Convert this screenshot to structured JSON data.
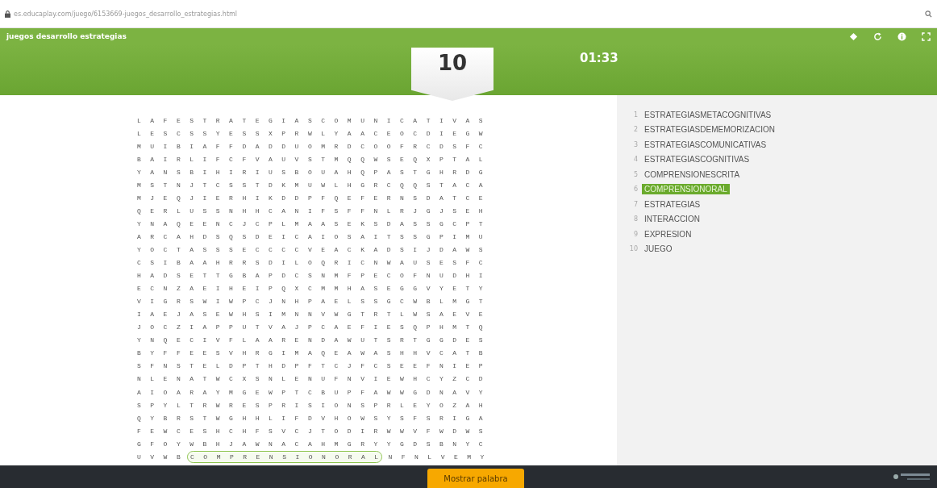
{
  "browser": {
    "url": "es.educaplay.com/juego/6153669-juegos_desarrollo_estrategias.html"
  },
  "header": {
    "title": "juegos desarrollo estrategias"
  },
  "score": "10",
  "timer": "01:33",
  "grid": {
    "rows": [
      {
        "segments": [
          {
            "text": "L A F E S T R A T E G I A S C O M U N I C A T I V A S",
            "found": false
          }
        ]
      },
      {
        "segments": [
          {
            "text": "L E S C S S Y E S S X P R W L Y A A C E O C D I E G W",
            "found": false
          }
        ]
      },
      {
        "segments": [
          {
            "text": "M U I B I A F F D A D D U O M R D C O O F R C D S F C",
            "found": false
          }
        ]
      },
      {
        "segments": [
          {
            "text": "B A I R L I F C F V A U V S T M Q Q W S E Q X P T A L",
            "found": false
          }
        ]
      },
      {
        "segments": [
          {
            "text": "Y A N S B I H I R I U S B O U A H Q P A S T G H R D G",
            "found": false
          }
        ]
      },
      {
        "segments": [
          {
            "text": "M S T N J T C S S T D K M U W L H G R C Q Q S T A C A",
            "found": false
          }
        ]
      },
      {
        "segments": [
          {
            "text": "M J E Q J I E R H I K D D P F Q E F E R N S D A T C E",
            "found": false
          }
        ]
      },
      {
        "segments": [
          {
            "text": "Q E R L U S S N H H C A N I F S F F N L R J G J S E H",
            "found": false
          }
        ]
      },
      {
        "segments": [
          {
            "text": "Y N A Q E E N C J C P L M A A S E K S D A S S G C P T",
            "found": false
          }
        ]
      },
      {
        "segments": [
          {
            "text": "A R C A H D S Q S D E I C A I O S A I T S S G P I M U",
            "found": false
          }
        ]
      },
      {
        "segments": [
          {
            "text": "Y O C T A S S S E C C C C V E A C K A D S I J D A W S",
            "found": false
          }
        ]
      },
      {
        "segments": [
          {
            "text": "C S I B A A H R R S D I L O Q R I C N W A U S E S F C",
            "found": false
          }
        ]
      },
      {
        "segments": [
          {
            "text": "H A D S E T T G B A P D C S N M F P E C O F N U D H I",
            "found": false
          }
        ]
      },
      {
        "segments": [
          {
            "text": "E C N Z A E I H E I P Q X C M M H A S E G G V Y E T Y",
            "found": false
          }
        ]
      },
      {
        "segments": [
          {
            "text": "V I G R S W I W P C J N H P A E L S S G C W B L M G T",
            "found": false
          }
        ]
      },
      {
        "segments": [
          {
            "text": "I A E J A S E W H S I M N N V W G T R T L W S A E V E",
            "found": false
          }
        ]
      },
      {
        "segments": [
          {
            "text": "J O C Z I A P P U T V A J P C A E F I E S Q P H M T Q",
            "found": false
          }
        ]
      },
      {
        "segments": [
          {
            "text": "Y N Q E C I V F L A A R E N D A W U T S R T G G D E S",
            "found": false
          }
        ]
      },
      {
        "segments": [
          {
            "text": "B Y F F E E S V H R G I M A Q E A W A S H H V C A T B",
            "found": false
          }
        ]
      },
      {
        "segments": [
          {
            "text": "S F N S T E L D P T H D P F T C J F C S E E F N I E P",
            "found": false
          }
        ]
      },
      {
        "segments": [
          {
            "text": "N L E N A T W C X S N L E N U F N V I E W H C Y Z C D",
            "found": false
          }
        ]
      },
      {
        "segments": [
          {
            "text": "A I O A R A Y M G E W P T C B U P F A W W G D N A V Y",
            "found": false
          }
        ]
      },
      {
        "segments": [
          {
            "text": "S P Y L T R W R E S P R I S I O N S P R L E Y O Z A H",
            "found": false
          }
        ]
      },
      {
        "segments": [
          {
            "text": "Q Y B R S T W G H H L I F D V H O W S Y S F S R I G A",
            "found": false
          }
        ]
      },
      {
        "segments": [
          {
            "text": "F E W C E S H C H F S V C J T O D I R W W V F W D W S",
            "found": false
          }
        ]
      },
      {
        "segments": [
          {
            "text": "G F O Y W B H J A W N A C A H M G R Y Y G D S B N Y C",
            "found": false
          }
        ]
      },
      {
        "segments": [
          {
            "text": "U V W B",
            "found": false
          },
          {
            "text": "C O M P R E N S I O N O R A L",
            "found": true
          },
          {
            "text": "N F N L V E M Y",
            "found": false
          }
        ]
      }
    ]
  },
  "words": [
    {
      "number": "1",
      "text": "ESTRATEGIASMETACOGNITIVAS",
      "found": false
    },
    {
      "number": "2",
      "text": "ESTRATEGIASDEMEMORIZACION",
      "found": false
    },
    {
      "number": "3",
      "text": "ESTRATEGIASCOMUNICATIVAS",
      "found": false
    },
    {
      "number": "4",
      "text": "ESTRATEGIASCOGNITIVAS",
      "found": false
    },
    {
      "number": "5",
      "text": "COMPRENSIONESCRITA",
      "found": false
    },
    {
      "number": "6",
      "text": "COMPRENSIONORAL",
      "found": true
    },
    {
      "number": "7",
      "text": "ESTRATEGIAS",
      "found": false
    },
    {
      "number": "8",
      "text": "INTERACCION",
      "found": false
    },
    {
      "number": "9",
      "text": "EXPRESION",
      "found": false
    },
    {
      "number": "10",
      "text": "JUEGO",
      "found": false
    }
  ],
  "footer": {
    "button": "Mostrar palabra"
  }
}
